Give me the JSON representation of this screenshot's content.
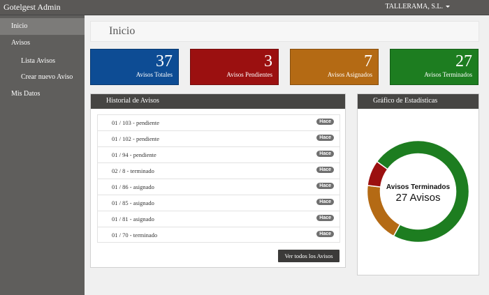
{
  "topbar": {
    "brand": "Gotelgest Admin",
    "user": "TALLERAMA, S.L."
  },
  "sidebar": {
    "items": [
      {
        "label": "Inicio"
      },
      {
        "label": "Avisos"
      },
      {
        "label": "Lista Avisos"
      },
      {
        "label": "Crear nuevo Aviso"
      },
      {
        "label": "Mis Datos"
      }
    ]
  },
  "page": {
    "title": "Inicio"
  },
  "stats": [
    {
      "value": "37",
      "label": "Avisos Totales",
      "color": "#0d4c94"
    },
    {
      "value": "3",
      "label": "Avisos Pendientes",
      "color": "#9b1010"
    },
    {
      "value": "7",
      "label": "Avisos Asignados",
      "color": "#b46a14"
    },
    {
      "value": "27",
      "label": "Avisos Terminados",
      "color": "#1d7d20"
    }
  ],
  "history": {
    "title": "Historial de Avisos",
    "badge": "Hace",
    "rows": [
      "01 / 103 - pendiente",
      "01 / 102 - pendiente",
      "01 / 94 - pendiente",
      "02 / 8 - terminado",
      "01 / 86 - asignado",
      "01 / 85 - asignado",
      "01 / 81 - asignado",
      "01 / 70 - terminado"
    ],
    "button": "Ver todos los Avisos"
  },
  "statsPanel": {
    "title": "Gráfico de Estadísticas",
    "center_title": "Avisos Terminados",
    "center_value": "27 Avisos"
  },
  "chart_data": {
    "type": "pie",
    "categories": [
      "Avisos Terminados",
      "Avisos Asignados",
      "Avisos Pendientes"
    ],
    "values": [
      27,
      7,
      3
    ],
    "colors": [
      "#1d7d20",
      "#b46a14",
      "#9b1010"
    ]
  }
}
